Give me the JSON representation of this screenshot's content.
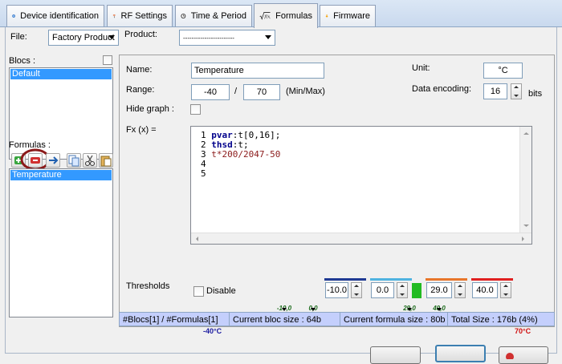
{
  "tabs": [
    {
      "label": "Device identification",
      "icon": "device-id-icon"
    },
    {
      "label": "RF Settings",
      "icon": "antenna-icon"
    },
    {
      "label": "Time & Period",
      "icon": "clock-icon"
    },
    {
      "label": "Formulas",
      "icon": "formula-icon"
    },
    {
      "label": "Firmware",
      "icon": "download-arrow-icon"
    }
  ],
  "file": {
    "label": "File:",
    "value": "Factory Product"
  },
  "product": {
    "label": "Product:",
    "value": "------------------------"
  },
  "blocs": {
    "label": "Blocs :",
    "items": [
      "Default"
    ]
  },
  "formulas": {
    "label": "Formulas :",
    "items": [
      "Temperature"
    ]
  },
  "editor": {
    "name_label": "Name:",
    "name_value": "Temperature",
    "unit_label": "Unit:",
    "unit_value": "°C",
    "range_label": "Range:",
    "range_min": "-40",
    "range_sep": "/",
    "range_max": "70",
    "range_hint": "(Min/Max)",
    "encoding_label": "Data encoding:",
    "encoding_value": "16",
    "encoding_unit": "bits",
    "hide_graph_label": "Hide graph :",
    "fx_label": "Fx (x) =",
    "code_lines": [
      {
        "num": "1",
        "kw": "pvar",
        "rest": ":t[0,16];"
      },
      {
        "num": "2",
        "kw": "thsd",
        "rest": ":t;"
      },
      {
        "num": "3",
        "kw": "",
        "rest": "t*200/2047-50"
      },
      {
        "num": "4",
        "kw": "",
        "rest": ""
      },
      {
        "num": "5",
        "kw": "",
        "rest": ""
      }
    ],
    "thresholds_label": "Thresholds",
    "disable_label": "Disable",
    "thresholds": [
      {
        "value": "-10.0",
        "color": "#1f3a93"
      },
      {
        "value": "0.0",
        "color": "#4fb3e0"
      },
      {
        "value": "29.0",
        "color": "#e8762b"
      },
      {
        "value": "40.0",
        "color": "#e02020"
      }
    ],
    "marker_labels": [
      "-10,0",
      "0,0",
      "29,0",
      "40,0"
    ],
    "min_label": "-40°C",
    "max_label": "70°C"
  },
  "status": {
    "counts": "#Blocs[1] / #Formulas[1]",
    "bloc_size": "Current bloc size : 64b",
    "formula_size": "Current formula size : 80b",
    "total_size": "Total Size : 176b (4%)"
  }
}
